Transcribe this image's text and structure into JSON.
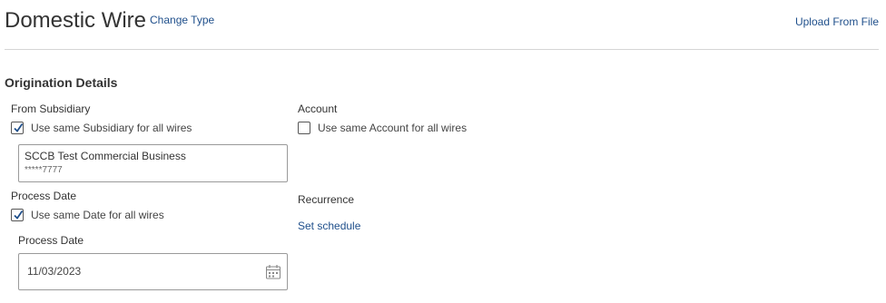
{
  "header": {
    "title": "Domestic Wire",
    "change_type": "Change Type",
    "upload_from_file": "Upload From File"
  },
  "origination": {
    "section_title": "Origination Details",
    "from_subsidiary": {
      "label": "From Subsidiary",
      "same_for_all": "Use same Subsidiary for all wires",
      "same_for_all_checked": true,
      "selected_name": "SCCB Test Commercial Business",
      "selected_account": "*****7777"
    },
    "account": {
      "label": "Account",
      "same_for_all": "Use same Account for all wires",
      "same_for_all_checked": false
    },
    "process_date": {
      "label": "Process Date",
      "same_for_all": "Use same Date for all wires",
      "same_for_all_checked": true,
      "field_label": "Process Date",
      "value": "11/03/2023"
    },
    "recurrence": {
      "label": "Recurrence",
      "set_schedule": "Set schedule"
    }
  },
  "colors": {
    "link": "#1f4f8b",
    "text": "#333333",
    "border": "#9a9a9a"
  }
}
